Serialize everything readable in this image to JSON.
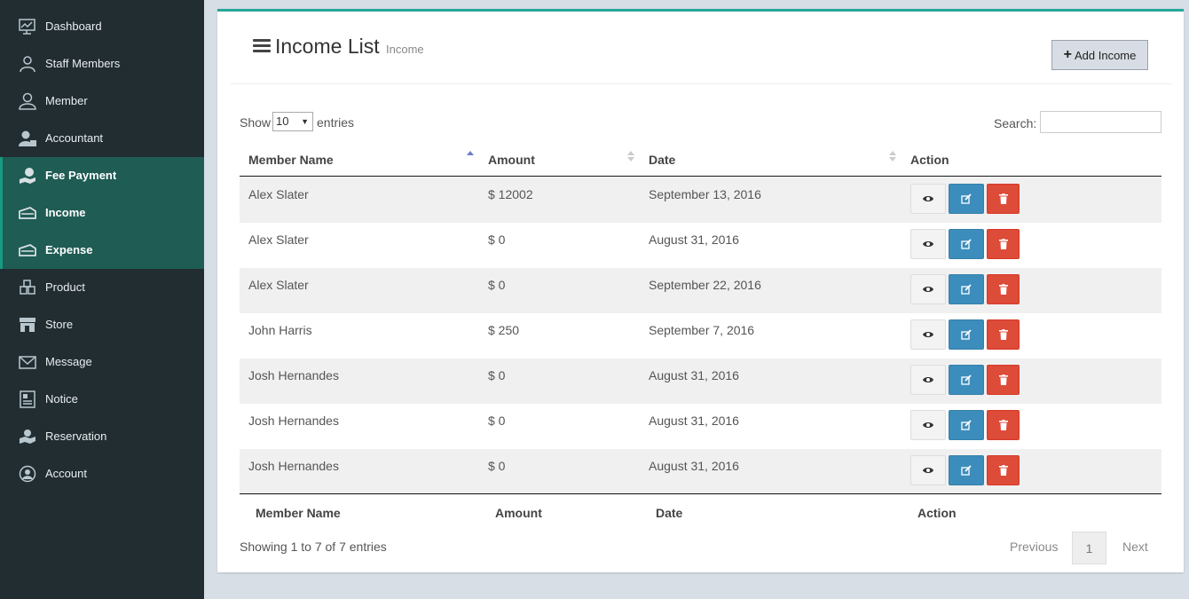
{
  "sidebar": {
    "items": [
      {
        "label": "Dashboard",
        "icon": "dashboard-icon"
      },
      {
        "label": "Staff Members",
        "icon": "staff-icon"
      },
      {
        "label": "Member",
        "icon": "member-icon"
      },
      {
        "label": "Accountant",
        "icon": "accountant-icon"
      },
      {
        "label": "Fee Payment",
        "icon": "fee-payment-icon"
      },
      {
        "label": "Income",
        "icon": "income-icon"
      },
      {
        "label": "Expense",
        "icon": "expense-icon"
      },
      {
        "label": "Product",
        "icon": "product-icon"
      },
      {
        "label": "Store",
        "icon": "store-icon"
      },
      {
        "label": "Message",
        "icon": "message-icon"
      },
      {
        "label": "Notice",
        "icon": "notice-icon"
      },
      {
        "label": "Reservation",
        "icon": "reservation-icon"
      },
      {
        "label": "Account",
        "icon": "account-icon"
      }
    ]
  },
  "header": {
    "title": "Income List",
    "subtitle": "Income",
    "add_button": "Add Income"
  },
  "controls": {
    "show_label": "Show",
    "page_size": "10",
    "entries_label": "entries",
    "search_label": "Search:"
  },
  "table": {
    "columns": [
      "Member Name",
      "Amount",
      "Date",
      "Action"
    ],
    "rows": [
      {
        "name": "Alex Slater",
        "amount": "$ 12002",
        "date": "September 13, 2016"
      },
      {
        "name": "Alex Slater",
        "amount": "$ 0",
        "date": "August 31, 2016"
      },
      {
        "name": "Alex Slater",
        "amount": "$ 0",
        "date": "September 22, 2016"
      },
      {
        "name": "John Harris",
        "amount": "$ 250",
        "date": "September 7, 2016"
      },
      {
        "name": "Josh Hernandes",
        "amount": "$ 0",
        "date": "August 31, 2016"
      },
      {
        "name": "Josh Hernandes",
        "amount": "$ 0",
        "date": "August 31, 2016"
      },
      {
        "name": "Josh Hernandes",
        "amount": "$ 0",
        "date": "August 31, 2016"
      }
    ]
  },
  "footer": {
    "info": "Showing 1 to 7 of 7 entries",
    "previous": "Previous",
    "current_page": "1",
    "next": "Next"
  },
  "colors": {
    "sidebar_bg": "#222d32",
    "active_bg": "#1f5c54",
    "accent": "#26a69a",
    "edit": "#3c8dbc",
    "delete": "#dd4b39"
  }
}
